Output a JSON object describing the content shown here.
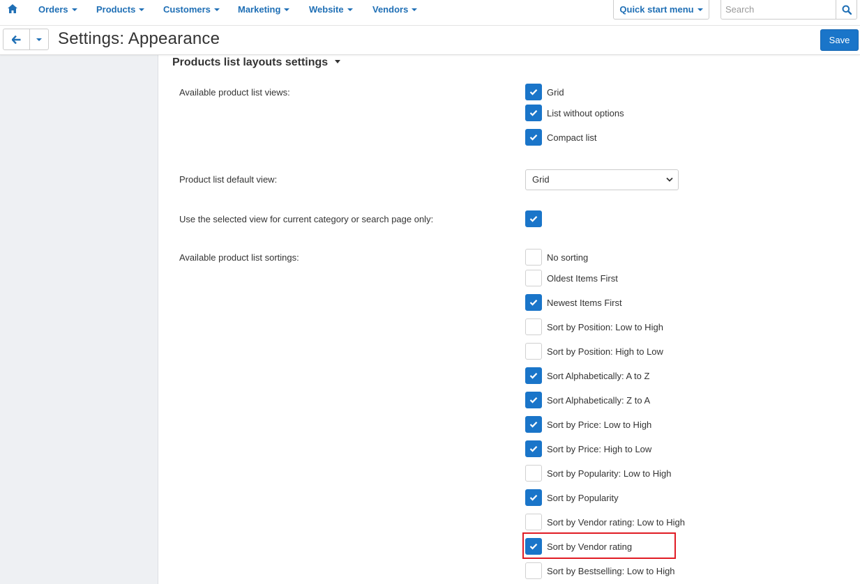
{
  "topnav": {
    "home_icon": "home-icon",
    "items": [
      {
        "label": "Orders"
      },
      {
        "label": "Products"
      },
      {
        "label": "Customers"
      },
      {
        "label": "Marketing"
      },
      {
        "label": "Website"
      },
      {
        "label": "Vendors"
      }
    ],
    "quick_start_label": "Quick start menu",
    "search_placeholder": "Search",
    "search_value": "",
    "search_icon": "search-icon"
  },
  "header": {
    "title": "Settings: Appearance",
    "save_label": "Save",
    "back_icon": "arrow-left-icon"
  },
  "section": {
    "title": "Products list layouts settings"
  },
  "settings": {
    "views_label": "Available product list views:",
    "views": [
      {
        "label": "Grid",
        "checked": true
      },
      {
        "label": "List without options",
        "checked": true
      },
      {
        "label": "Compact list",
        "checked": true
      }
    ],
    "default_view_label": "Product list default view:",
    "default_view_value": "Grid",
    "selected_view_label": "Use the selected view for current category or search page only:",
    "selected_view_checked": true,
    "sortings_label": "Available product list sortings:",
    "sortings": [
      {
        "label": "No sorting",
        "checked": false
      },
      {
        "label": "Oldest Items First",
        "checked": false
      },
      {
        "label": "Newest Items First",
        "checked": true
      },
      {
        "label": "Sort by Position: Low to High",
        "checked": false
      },
      {
        "label": "Sort by Position: High to Low",
        "checked": false
      },
      {
        "label": "Sort Alphabetically: A to Z",
        "checked": true
      },
      {
        "label": "Sort Alphabetically: Z to A",
        "checked": true
      },
      {
        "label": "Sort by Price: Low to High",
        "checked": true
      },
      {
        "label": "Sort by Price: High to Low",
        "checked": true
      },
      {
        "label": "Sort by Popularity: Low to High",
        "checked": false
      },
      {
        "label": "Sort by Popularity",
        "checked": true
      },
      {
        "label": "Sort by Vendor rating: Low to High",
        "checked": false
      },
      {
        "label": "Sort by Vendor rating",
        "checked": true
      },
      {
        "label": "Sort by Bestselling: Low to High",
        "checked": false
      }
    ]
  },
  "colors": {
    "accent": "#1a75c9",
    "nav_link": "#1f6fb5",
    "highlight": "#e01b24",
    "sidebar_bg": "#eef0f3"
  }
}
